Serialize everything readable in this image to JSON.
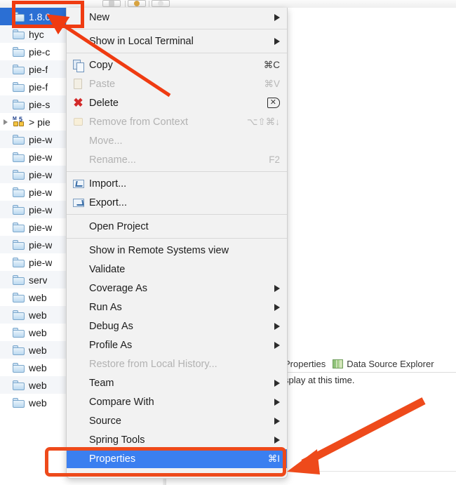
{
  "app": {
    "type": "eclipse-ide",
    "accent_selection": "#2b6fd4",
    "menu_highlight": "#3b7ff0",
    "annotation_color": "#ee4a1b"
  },
  "toolbar": {
    "buttons": [
      "toolbar-button-1",
      "toolbar-button-2",
      "toolbar-button-3",
      "toolbar-button-4"
    ]
  },
  "tree": {
    "items": [
      {
        "label": "1.8.0",
        "icon": "folder-icon",
        "selected": true,
        "expandable": false
      },
      {
        "label": "hyc",
        "icon": "folder-icon",
        "selected": false,
        "expandable": false
      },
      {
        "label": "pie-c",
        "icon": "folder-icon",
        "selected": false,
        "expandable": false
      },
      {
        "label": "pie-f",
        "icon": "folder-icon",
        "selected": false,
        "expandable": false
      },
      {
        "label": "pie-f",
        "icon": "folder-icon",
        "selected": false,
        "expandable": false
      },
      {
        "label": "pie-s",
        "icon": "folder-icon",
        "selected": false,
        "expandable": false
      },
      {
        "label": "> pie",
        "icon": "maven-project-icon",
        "selected": false,
        "expandable": true
      },
      {
        "label": "pie-w",
        "icon": "folder-icon",
        "selected": false,
        "expandable": false
      },
      {
        "label": "pie-w",
        "icon": "folder-icon",
        "selected": false,
        "expandable": false
      },
      {
        "label": "pie-w",
        "icon": "folder-icon",
        "selected": false,
        "expandable": false
      },
      {
        "label": "pie-w",
        "icon": "folder-icon",
        "selected": false,
        "expandable": false
      },
      {
        "label": "pie-w",
        "icon": "folder-icon",
        "selected": false,
        "expandable": false
      },
      {
        "label": "pie-w",
        "icon": "folder-icon",
        "selected": false,
        "expandable": false
      },
      {
        "label": "pie-w",
        "icon": "folder-icon",
        "selected": false,
        "expandable": false
      },
      {
        "label": "pie-w",
        "icon": "folder-icon",
        "selected": false,
        "expandable": false
      },
      {
        "label": "serv",
        "icon": "folder-icon",
        "selected": false,
        "expandable": false
      },
      {
        "label": "web",
        "icon": "folder-icon",
        "selected": false,
        "expandable": false
      },
      {
        "label": "web",
        "icon": "folder-icon",
        "selected": false,
        "expandable": false
      },
      {
        "label": "web",
        "icon": "folder-icon",
        "selected": false,
        "expandable": false
      },
      {
        "label": "web",
        "icon": "folder-icon",
        "selected": false,
        "expandable": false
      },
      {
        "label": "web",
        "icon": "folder-icon",
        "selected": false,
        "expandable": false
      },
      {
        "label": "web",
        "icon": "folder-icon",
        "selected": false,
        "expandable": false
      },
      {
        "label": "web",
        "icon": "folder-icon",
        "selected": false,
        "expandable": false
      }
    ]
  },
  "context_menu": {
    "items": [
      {
        "label": "New",
        "icon": "",
        "accel": "",
        "submenu": true,
        "disabled": false,
        "highlight": false
      },
      {
        "separator": true
      },
      {
        "label": "Show in Local Terminal",
        "icon": "",
        "accel": "",
        "submenu": true,
        "disabled": false,
        "highlight": false
      },
      {
        "separator": true
      },
      {
        "label": "Copy",
        "icon": "copy-icon",
        "accel": "⌘C",
        "submenu": false,
        "disabled": false,
        "highlight": false
      },
      {
        "label": "Paste",
        "icon": "paste-icon",
        "accel": "⌘V",
        "submenu": false,
        "disabled": true,
        "highlight": false
      },
      {
        "label": "Delete",
        "icon": "delete-icon",
        "accel": "delete-key",
        "submenu": false,
        "disabled": false,
        "highlight": false
      },
      {
        "label": "Remove from Context",
        "icon": "remove-from-context-icon",
        "accel": "⌥⇧⌘↓",
        "submenu": false,
        "disabled": true,
        "highlight": false
      },
      {
        "label": "Move...",
        "icon": "",
        "accel": "",
        "submenu": false,
        "disabled": true,
        "highlight": false
      },
      {
        "label": "Rename...",
        "icon": "",
        "accel": "F2",
        "submenu": false,
        "disabled": true,
        "highlight": false
      },
      {
        "separator": true
      },
      {
        "label": "Import...",
        "icon": "import-icon",
        "accel": "",
        "submenu": false,
        "disabled": false,
        "highlight": false
      },
      {
        "label": "Export...",
        "icon": "export-icon",
        "accel": "",
        "submenu": false,
        "disabled": false,
        "highlight": false
      },
      {
        "separator": true
      },
      {
        "label": "Open Project",
        "icon": "",
        "accel": "",
        "submenu": false,
        "disabled": false,
        "highlight": false
      },
      {
        "separator": true
      },
      {
        "label": "Show in Remote Systems view",
        "icon": "",
        "accel": "",
        "submenu": false,
        "disabled": false,
        "highlight": false
      },
      {
        "label": "Validate",
        "icon": "",
        "accel": "",
        "submenu": false,
        "disabled": false,
        "highlight": false
      },
      {
        "label": "Coverage As",
        "icon": "",
        "accel": "",
        "submenu": true,
        "disabled": false,
        "highlight": false
      },
      {
        "label": "Run As",
        "icon": "",
        "accel": "",
        "submenu": true,
        "disabled": false,
        "highlight": false
      },
      {
        "label": "Debug As",
        "icon": "",
        "accel": "",
        "submenu": true,
        "disabled": false,
        "highlight": false
      },
      {
        "label": "Profile As",
        "icon": "",
        "accel": "",
        "submenu": true,
        "disabled": false,
        "highlight": false
      },
      {
        "label": "Restore from Local History...",
        "icon": "",
        "accel": "",
        "submenu": false,
        "disabled": true,
        "highlight": false
      },
      {
        "label": "Team",
        "icon": "",
        "accel": "",
        "submenu": true,
        "disabled": false,
        "highlight": false
      },
      {
        "label": "Compare With",
        "icon": "",
        "accel": "",
        "submenu": true,
        "disabled": false,
        "highlight": false
      },
      {
        "label": "Source",
        "icon": "",
        "accel": "",
        "submenu": true,
        "disabled": false,
        "highlight": false
      },
      {
        "label": "Spring Tools",
        "icon": "",
        "accel": "",
        "submenu": true,
        "disabled": false,
        "highlight": false
      },
      {
        "label": "Properties",
        "icon": "",
        "accel": "⌘I",
        "submenu": false,
        "disabled": false,
        "highlight": true
      }
    ]
  },
  "view_area": {
    "tabs": [
      {
        "label": "Properties",
        "icon": ""
      },
      {
        "label": "Data Source Explorer",
        "icon": "data-source-explorer-icon"
      }
    ],
    "message": "splay at this time."
  },
  "annotations": {
    "top_box_target": "1.8.0",
    "bottom_box_target": "Properties",
    "arrow_count": 2
  }
}
